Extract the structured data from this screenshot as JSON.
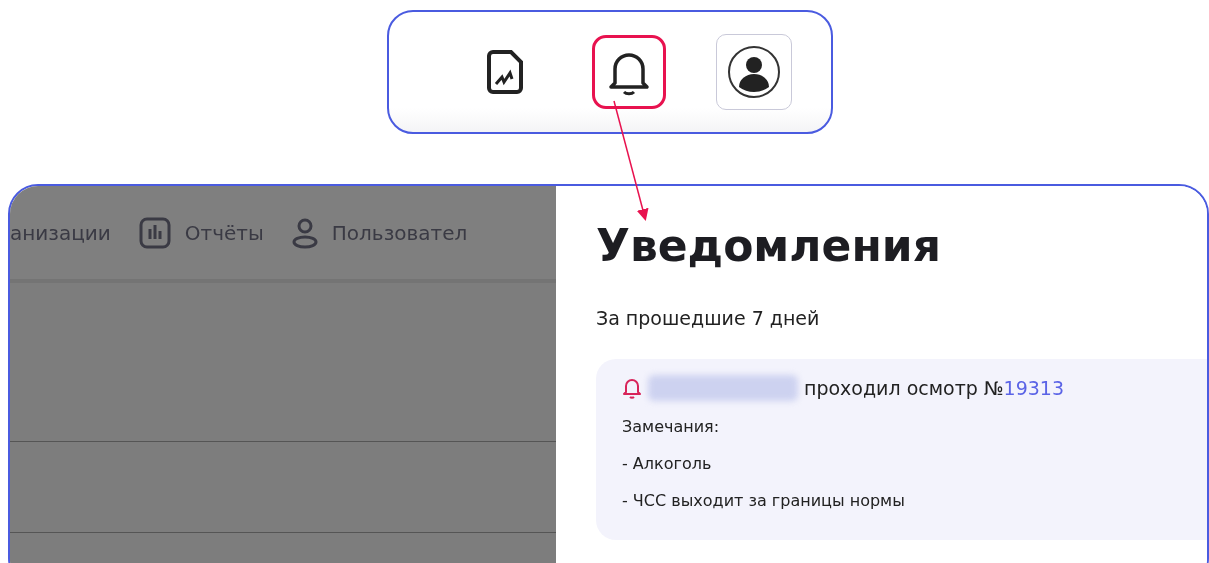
{
  "toolbar": {
    "icons": [
      {
        "kind": "document",
        "highlighted": false
      },
      {
        "kind": "bell",
        "highlighted": true
      },
      {
        "kind": "avatar",
        "highlighted": false
      }
    ]
  },
  "nav": {
    "items": [
      {
        "kind": "none",
        "label": "анизации"
      },
      {
        "kind": "chart",
        "label": "Отчёты"
      },
      {
        "kind": "user",
        "label": "Пользовател"
      }
    ]
  },
  "notifications": {
    "title": "Уведомления",
    "period": "За прошедшие 7 дней",
    "items": [
      {
        "message": "проходил осмотр №",
        "exam_number": "19313",
        "remarks_label": "Замечания:",
        "remarks": [
          "- Алкоголь",
          "- ЧСС выходит за границы нормы"
        ]
      }
    ]
  }
}
